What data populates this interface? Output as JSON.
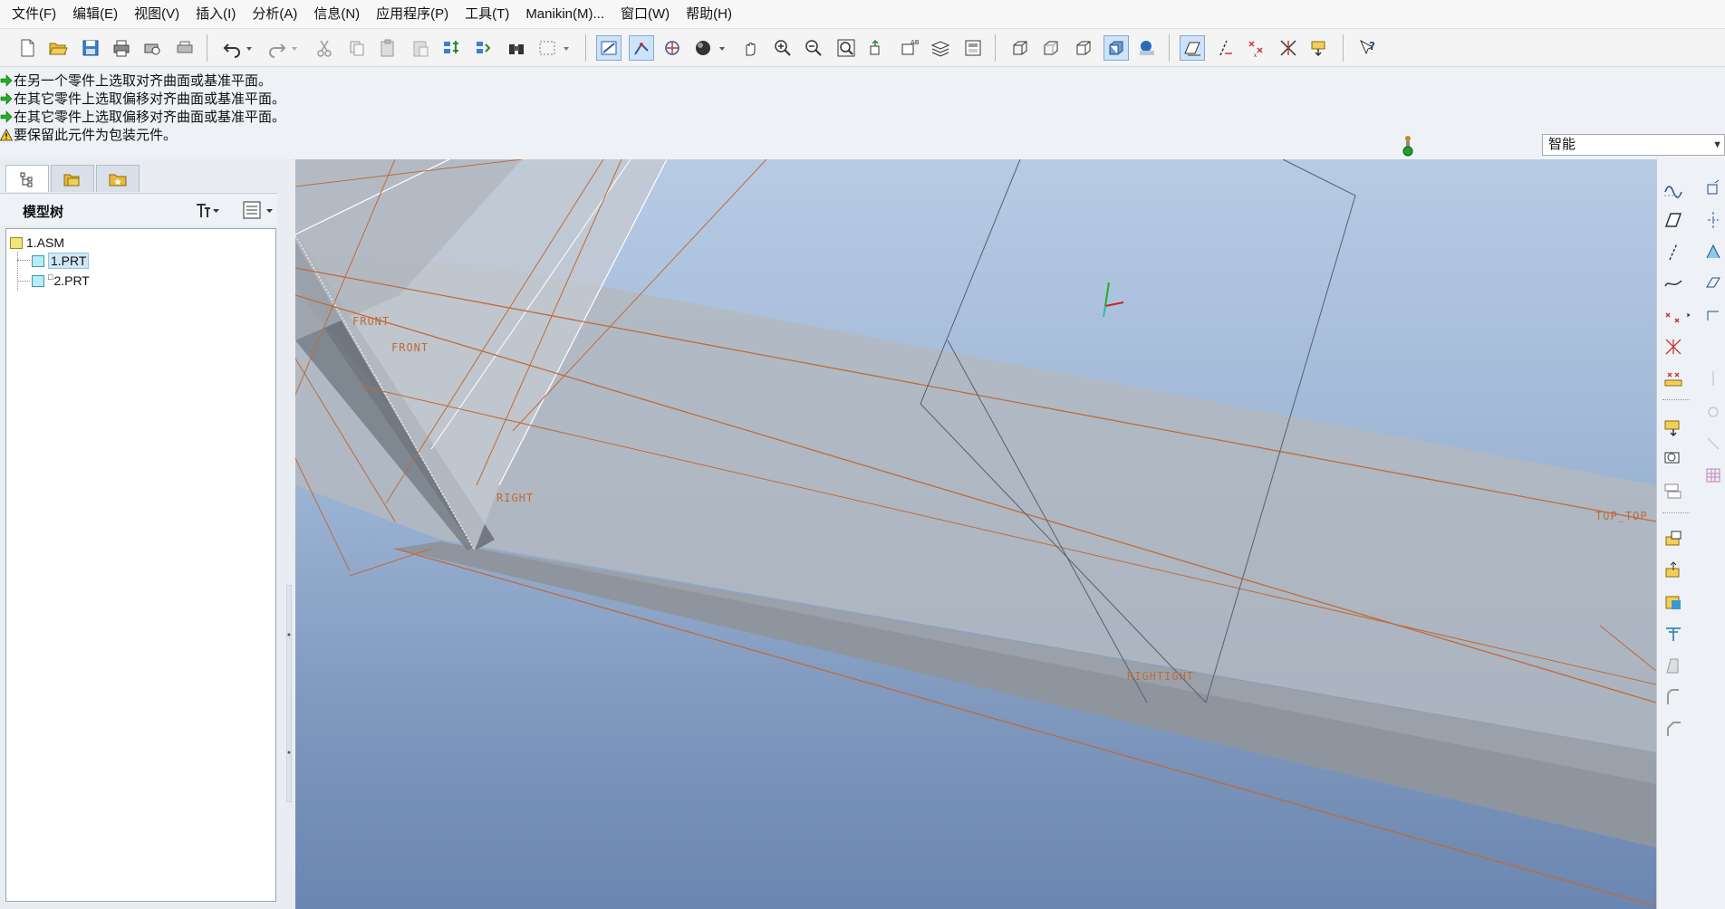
{
  "menu": [
    "文件(F)",
    "编辑(E)",
    "视图(V)",
    "插入(I)",
    "分析(A)",
    "信息(N)",
    "应用程序(P)",
    "工具(T)",
    "Manikin(M)...",
    "窗口(W)",
    "帮助(H)"
  ],
  "messages": [
    {
      "type": "prompt",
      "text": "在另一个零件上选取对齐曲面或基准平面。"
    },
    {
      "type": "prompt",
      "text": "在其它零件上选取偏移对齐曲面或基准平面。"
    },
    {
      "type": "prompt",
      "text": "在其它零件上选取偏移对齐曲面或基准平面。"
    },
    {
      "type": "warning",
      "text": "要保留此元件为包装元件。"
    }
  ],
  "filter": {
    "value": "智能"
  },
  "navigator": {
    "title": "模型树",
    "tree": [
      {
        "label": "1.ASM",
        "level": 0,
        "selected": false
      },
      {
        "label": "1.PRT",
        "level": 1,
        "selected": true
      },
      {
        "label": "2.PRT",
        "level": 1,
        "selected": false,
        "prefix": "□"
      }
    ]
  },
  "viewport": {
    "datum_labels": {
      "front_1": "FRONT",
      "front_2": "FRONT",
      "right_1": "RIGHT",
      "right_2": "RIGHTIGHT",
      "top": "TOP_TOP"
    }
  },
  "colors": {
    "datum_plane": "#c06a38",
    "selection_bg": "#cfe3f7",
    "viewport_top": "#b7cbe4",
    "viewport_bottom": "#6b86b0"
  }
}
